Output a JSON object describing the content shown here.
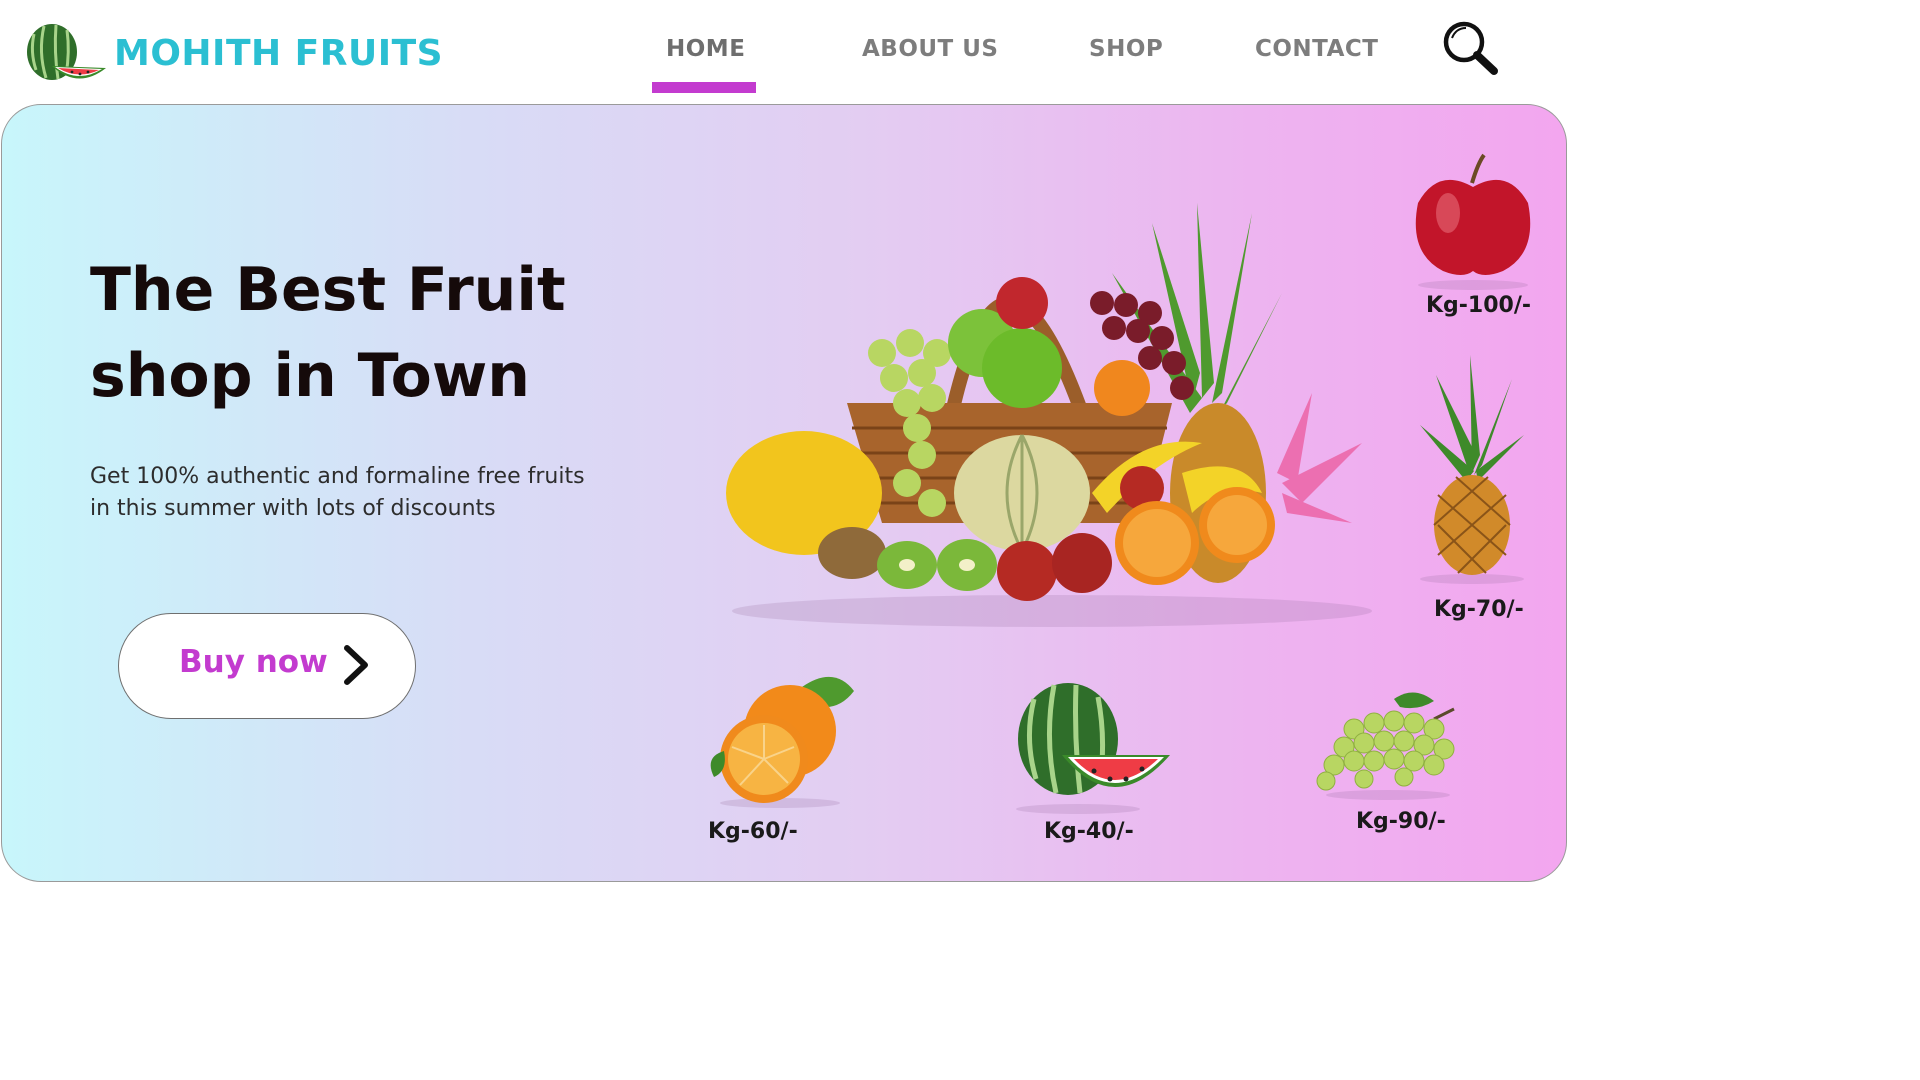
{
  "brand": {
    "name": "MOHITH FRUITS",
    "logo_icon": "watermelon-logo-icon",
    "color": "#2bbfd2"
  },
  "nav": {
    "items": [
      {
        "label": "HOME",
        "active": true
      },
      {
        "label": "ABOUT US",
        "active": false
      },
      {
        "label": "SHOP",
        "active": false
      },
      {
        "label": "CONTACT",
        "active": false
      }
    ],
    "active_color": "#c33bcf",
    "search_icon": "search-icon"
  },
  "hero": {
    "title_line1": "The Best Fruit",
    "title_line2": "shop in Town",
    "subtitle_line1": "Get 100% authentic and formaline free fruits",
    "subtitle_line2": "in this summer with lots of discounts",
    "cta_label": "Buy now",
    "cta_icon": "chevron-right-icon",
    "gradient": [
      "#c8f6fb",
      "#f3a6ef"
    ]
  },
  "products": [
    {
      "fruit": "apple",
      "icon": "apple-icon",
      "price": "Kg-100/-"
    },
    {
      "fruit": "pineapple",
      "icon": "pineapple-icon",
      "price": "Kg-70/-"
    },
    {
      "fruit": "orange",
      "icon": "orange-icon",
      "price": "Kg-60/-"
    },
    {
      "fruit": "watermelon",
      "icon": "watermelon-icon",
      "price": "Kg-40/-"
    },
    {
      "fruit": "grapes",
      "icon": "grapes-icon",
      "price": "Kg-90/-"
    }
  ]
}
